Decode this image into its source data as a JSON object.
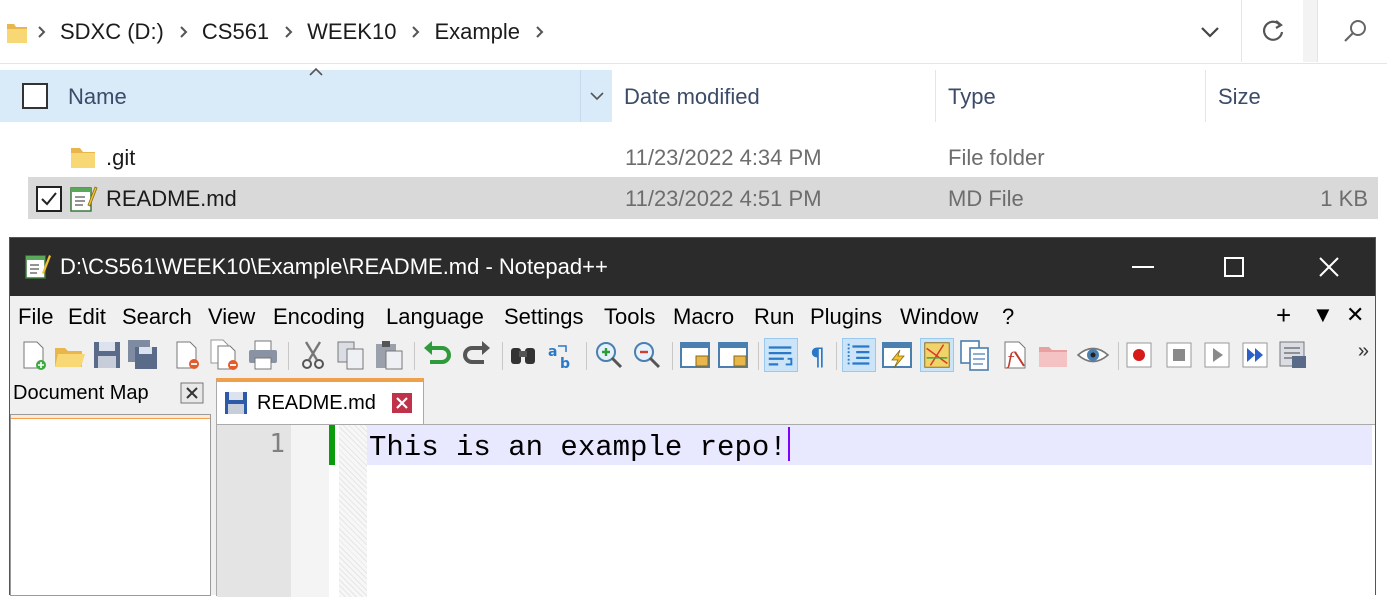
{
  "explorer": {
    "breadcrumbs": [
      "SDXC (D:)",
      "CS561",
      "WEEK10",
      "Example"
    ],
    "columns": {
      "name": "Name",
      "date": "Date modified",
      "type": "Type",
      "size": "Size"
    },
    "files": [
      {
        "name": ".git",
        "date": "11/23/2022 4:34 PM",
        "type": "File folder",
        "size": "",
        "selected": false,
        "icon": "folder-icon"
      },
      {
        "name": "README.md",
        "date": "11/23/2022 4:51 PM",
        "type": "MD File",
        "size": "1 KB",
        "selected": true,
        "icon": "notepadpp-file-icon"
      }
    ]
  },
  "notepad": {
    "title": "D:\\CS561\\WEEK10\\Example\\README.md - Notepad++",
    "menu": [
      "File",
      "Edit",
      "Search",
      "View",
      "Encoding",
      "Language",
      "Settings",
      "Tools",
      "Macro",
      "Run",
      "Plugins",
      "Window",
      "?"
    ],
    "menu_right": [
      "+",
      "▼",
      "✕"
    ],
    "toolbar_more": "»",
    "doc_map": {
      "title": "Document Map"
    },
    "tabs": [
      {
        "label": "README.md"
      }
    ],
    "editor": {
      "line_number": "1",
      "line_text": "This is an example repo!"
    },
    "colors": {
      "titlebar": "#2b2b2b",
      "tab_accent": "#f0a04a",
      "current_line": "#e8e8ff",
      "change_marker": "#0a9c0a",
      "caret": "#8000ff"
    }
  }
}
